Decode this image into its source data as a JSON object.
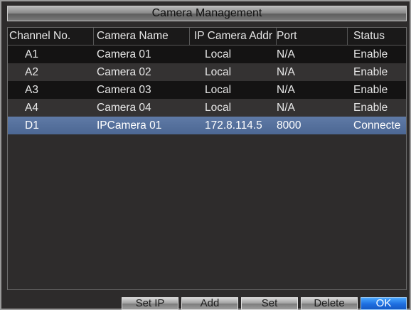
{
  "window": {
    "title": "Camera Management"
  },
  "table": {
    "columns": [
      "Channel No.",
      "Camera Name",
      "IP Camera Addr",
      "Port",
      "Status"
    ],
    "rows": [
      {
        "channel": "A1",
        "name": "Camera 01",
        "ip": "Local",
        "port": "N/A",
        "status": "Enable",
        "selected": false
      },
      {
        "channel": "A2",
        "name": "Camera 02",
        "ip": "Local",
        "port": "N/A",
        "status": "Enable",
        "selected": false
      },
      {
        "channel": "A3",
        "name": "Camera 03",
        "ip": "Local",
        "port": "N/A",
        "status": "Enable",
        "selected": false
      },
      {
        "channel": "A4",
        "name": "Camera 04",
        "ip": "Local",
        "port": "N/A",
        "status": "Enable",
        "selected": false
      },
      {
        "channel": "D1",
        "name": "IPCamera 01",
        "ip": "172.8.114.5",
        "port": "8000",
        "status": "Connecte",
        "selected": true
      }
    ]
  },
  "buttons": {
    "set_ip": "Set IP",
    "add": "Add",
    "set": "Set",
    "delete": "Delete",
    "ok": "OK"
  },
  "colors": {
    "selected_row": "#5a74a0",
    "ok_button": "#1e6ee0"
  }
}
